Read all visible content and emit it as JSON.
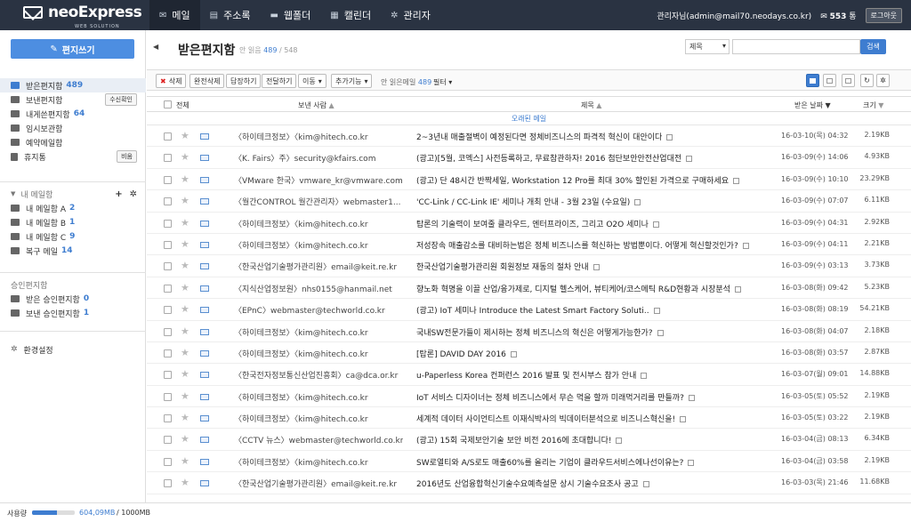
{
  "header": {
    "brand": "neoExpress",
    "brand_sub": "WEB SOLUTION",
    "nav": [
      {
        "label": "메일",
        "icon": "mail-icon"
      },
      {
        "label": "주소록",
        "icon": "address-book-icon"
      },
      {
        "label": "웹폴더",
        "icon": "folder-icon"
      },
      {
        "label": "캘린더",
        "icon": "calendar-icon"
      },
      {
        "label": "관리자",
        "icon": "gear-icon"
      }
    ],
    "user": "관리자님(admin@mail70.neodays.co.kr)",
    "notify_count": "553",
    "notify_unit": "통",
    "logout": "로그아웃"
  },
  "sidebar": {
    "compose": "편지쓰기",
    "folders": [
      {
        "label": "받은편지함",
        "count": "489",
        "active": true,
        "icon": "inbox-icon"
      },
      {
        "label": "보낸편지함",
        "count": "",
        "button": "수신확인",
        "icon": "folder-icon"
      },
      {
        "label": "내게쓴편지함",
        "count": "64",
        "icon": "folder-icon"
      },
      {
        "label": "임시보관함",
        "count": "",
        "icon": "folder-icon"
      },
      {
        "label": "예약메일함",
        "count": "",
        "icon": "folder-icon"
      },
      {
        "label": "휴지통",
        "count": "",
        "button": "비움",
        "icon": "trash-icon"
      }
    ],
    "my_section": "내 메일함",
    "my_folders": [
      {
        "label": "내 메일함 A",
        "count": "2"
      },
      {
        "label": "내 메일함 B",
        "count": "1"
      },
      {
        "label": "내 메일함 C",
        "count": "9"
      },
      {
        "label": "복구 메일",
        "count": "14"
      }
    ],
    "approval_section": "승인편지함",
    "approval_folders": [
      {
        "label": "받은 승인편지함",
        "count": "0"
      },
      {
        "label": "보낸 승인편지함",
        "count": "1"
      }
    ],
    "settings": "환경설정"
  },
  "main": {
    "title": "받은편지함",
    "unread_label": "안 읽음",
    "unread": "489",
    "total": "/ 548",
    "search_select": "제목",
    "search_button": "검색",
    "toolbar": {
      "delete": "삭제",
      "perm_delete": "완전삭제",
      "reply": "답장하기",
      "forward": "전달하기",
      "move": "이동",
      "more": "추가기능",
      "unread_mail_label": "안 읽은메일",
      "unread_mail_count": "489",
      "filter": "필터"
    },
    "columns": {
      "all": "전체",
      "from": "보낸 사람",
      "subject": "제목",
      "date": "받은 날짜",
      "size": "크기"
    },
    "old_label": "오래된 메일",
    "rows": [
      {
        "from": "〈하이테크정보〉〈kim@hitech.co.kr",
        "subject": "2~3년내 매출절벽이 예정된다면 정체비즈니스의 파격적 혁신이 대안이다",
        "date": "16-03-10(목) 04:32",
        "size": "2.19KB"
      },
      {
        "from": "〈K. Fairs〉주〉security@kfairs.com",
        "subject": "(광고)[5월, 코엑스] 사전등록하고, 무료참관하자! 2016 첨단보안안전산업대전",
        "date": "16-03-09(수) 14:06",
        "size": "4.93KB"
      },
      {
        "from": "〈VMware 한국〉vmware_kr@vmware.com",
        "subject": "(광고) 단 48시간 반짝세일, Workstation 12 Pro를 최대 30% 할인된 가격으로 구매하세요",
        "date": "16-03-09(수) 10:10",
        "size": "23.29KB"
      },
      {
        "from": "〈월간CONTROL 월간관리자〉webmaster1...",
        "subject": "'CC-Link / CC-Link IE' 세미나 개최 안내 - 3월 23일 (수요일)",
        "date": "16-03-09(수) 07:07",
        "size": "6.11KB"
      },
      {
        "from": "〈하이테크정보〉〈kim@hitech.co.kr",
        "subject": "탑론의 기술력이 보여줄 클라우드, 엔터프라이즈, 그리고 O2O 세미나",
        "date": "16-03-09(수) 04:31",
        "size": "2.92KB"
      },
      {
        "from": "〈하이테크정보〉〈kim@hitech.co.kr",
        "subject": "저성장속 매출감소를 대비하는법은 정체 비즈니스를 혁신하는 방법뿐이다. 어떻게 혁신할것인가?",
        "date": "16-03-09(수) 04:11",
        "size": "2.21KB"
      },
      {
        "from": "〈한국산업기술평가관리원〉email@keit.re.kr",
        "subject": "한국산업기술평가관리원 회원정보 재동의 절차 안내",
        "date": "16-03-09(수) 03:13",
        "size": "3.73KB"
      },
      {
        "from": "〈지식산업정보원〉nhs0155@hanmail.net",
        "subject": "향노화 혁명을 이끌 산업/융가제로, 디지털 헬스케어, 뷰티케어/코스메틱 R&D현황과 시장분석",
        "date": "16-03-08(화) 09:42",
        "size": "5.23KB"
      },
      {
        "from": "〈EPnC〉webmaster@techworld.co.kr",
        "subject": "(광고) IoT 세미나 Introduce the Latest Smart Factory Soluti..",
        "date": "16-03-08(화) 08:19",
        "size": "54.21KB"
      },
      {
        "from": "〈하이테크정보〉〈kim@hitech.co.kr",
        "subject": "국내SW전문가들이 제시하는 정체 비즈니스의 혁신은 어떻게가능한가?",
        "date": "16-03-08(화) 04:07",
        "size": "2.18KB"
      },
      {
        "from": "〈하이테크정보〉〈kim@hitech.co.kr",
        "subject": "[탑론] DAVID DAY 2016",
        "date": "16-03-08(화) 03:57",
        "size": "2.87KB"
      },
      {
        "from": "〈한국전자정보통신산업진흥회〉ca@dca.or.kr",
        "subject": "u-Paperless Korea 컨퍼런스 2016 발표 및 전시부스 참가 안내",
        "date": "16-03-07(월) 09:01",
        "size": "14.88KB"
      },
      {
        "from": "〈하이테크정보〉〈kim@hitech.co.kr",
        "subject": "IoT 서비스 디자이너는 정체 비즈니스에서 무슨 먹을 할까 미래먹거리를 만들까?",
        "date": "16-03-05(토) 05:52",
        "size": "2.19KB"
      },
      {
        "from": "〈하이테크정보〉〈kim@hitech.co.kr",
        "subject": "세계적 데이터 사이언티스트 이재식박사의 빅데이터분석으로 비즈니스혁신을!",
        "date": "16-03-05(토) 03:22",
        "size": "2.19KB"
      },
      {
        "from": "〈CCTV 뉴스〉webmaster@techworld.co.kr",
        "subject": "(광고) 15회 국제보안기술 보안 비전 2016에 초대합니다!",
        "date": "16-03-04(금) 08:13",
        "size": "6.34KB"
      },
      {
        "from": "〈하이테크정보〉〈kim@hitech.co.kr",
        "subject": "SW로열티와 A/S로도 매출60%를 올리는 기업이 클라우드서비스에나선이유는?",
        "date": "16-03-04(금) 03:58",
        "size": "2.19KB"
      },
      {
        "from": "〈한국산업기술평가관리원〉email@keit.re.kr",
        "subject": "2016년도 산업융합혁신기술수요예측설문 상시 기술수요조사 공고",
        "date": "16-03-03(목) 21:46",
        "size": "11.68KB"
      }
    ]
  },
  "footer": {
    "usage_label": "사용량",
    "usage_fraction": 0.59,
    "used": "604,09MB",
    "total": "/ 1000MB"
  },
  "colors": {
    "topbar": "#2a3342",
    "accent": "#3e7dd0"
  }
}
